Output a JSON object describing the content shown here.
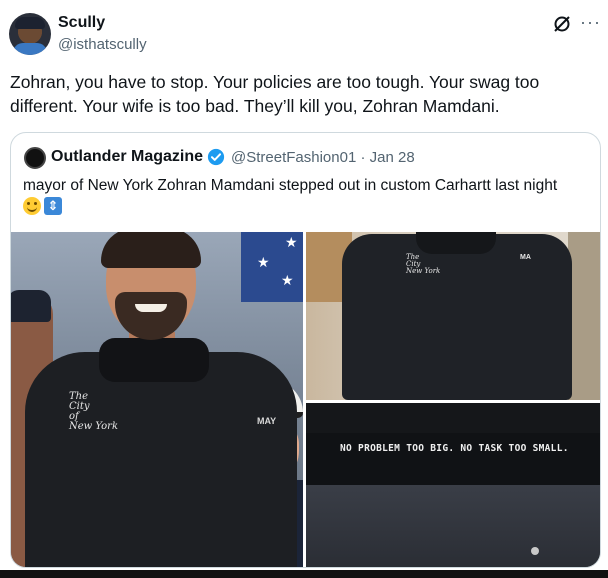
{
  "author": {
    "name": "Scully",
    "handle": "@isthatscully"
  },
  "tweet": {
    "text": "Zohran, you have to stop. Your policies are too tough. Your swag too different. Your wife is too bad. They’ll kill you, Zohran Mamdani."
  },
  "quote": {
    "name": "Outlander Magazine",
    "handle_date": "@StreetFashion01 · Jan 28",
    "text": "mayor of New York Zohran Mamdani stepped out in custom Carhartt last night",
    "emojis": [
      "smiling-face-emoji",
      "up-down-arrow-emoji"
    ],
    "images": {
      "main": {
        "logo_line1": "The",
        "logo_line2": "City",
        "logo_line3": "of",
        "logo_line4": "New York",
        "tag": "MAY"
      },
      "top_right": {
        "logo_line1": "The",
        "logo_line2": "City",
        "logo_line3": "New York",
        "tag": "MA"
      },
      "bottom_right": {
        "print": "NO PROBLEM  TOO BIG. NO TASK  TOO SMALL."
      }
    }
  },
  "icons": {
    "grok": "grok-icon",
    "more": "more-icon",
    "verified": "verified-badge-icon"
  },
  "colors": {
    "text": "#0f1419",
    "secondary": "#536471",
    "border": "#cfd9de",
    "verified": "#1d9bf0"
  }
}
